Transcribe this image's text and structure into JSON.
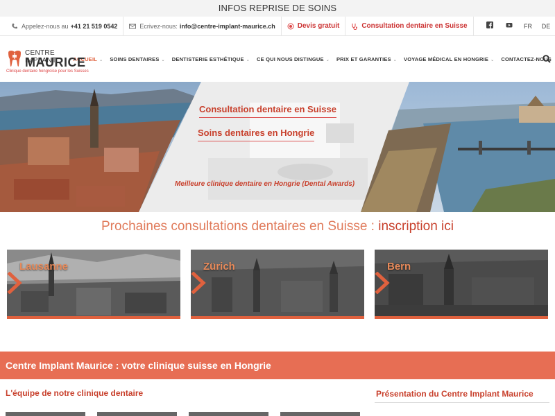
{
  "topbar": {
    "text": "INFOS REPRISE DE SOINS"
  },
  "contact": {
    "phone_label": "Appelez-nous au",
    "phone": "+41 21 519 0542",
    "email_label": "Ecrivez-nous:",
    "email": "info@centre-implant-maurice.ch",
    "quote": "Devis gratuit",
    "consult": "Consultation dentaire en Suisse"
  },
  "languages": [
    "FR",
    "DE"
  ],
  "logo": {
    "line1": "CENTRE IMPLANT",
    "line2": "MAURICE",
    "tagline": "Clinique dentaire hongroise pour les Suisses"
  },
  "nav": [
    {
      "label": "ACCUEIL",
      "active": true
    },
    {
      "label": "SOINS DENTAIRES",
      "active": false
    },
    {
      "label": "DENTISTERIE ESTHÉTIQUE",
      "active": false
    },
    {
      "label": "CE QUI NOUS DISTINGUE",
      "active": false
    },
    {
      "label": "PRIX ET GARANTIES",
      "active": false
    },
    {
      "label": "VOYAGE MÉDICAL EN HONGRIE",
      "active": false
    },
    {
      "label": "CONTACTEZ-NOUS",
      "active": false
    }
  ],
  "hero": {
    "line1": "Consultation dentaire en Suisse",
    "line2": "Soins dentaires en Hongrie",
    "award": "Meilleure clinique dentaire en Hongrie (Dental Awards)"
  },
  "consultations": {
    "title": "Prochaines consultations dentaires en Suisse :",
    "link": "inscription ici"
  },
  "cities": [
    {
      "name": "Lausanne"
    },
    {
      "name": "Zürich"
    },
    {
      "name": "Bern"
    }
  ],
  "banner": {
    "text": "Centre Implant Maurice : votre clinique suisse en Hongrie"
  },
  "sections": {
    "team": "L'équipe de notre clinique dentaire",
    "presentation": "Présentation du Centre Implant Maurice"
  },
  "colors": {
    "accent": "#e0613e",
    "banner": "#e76e54",
    "text_red": "#c8402c"
  }
}
